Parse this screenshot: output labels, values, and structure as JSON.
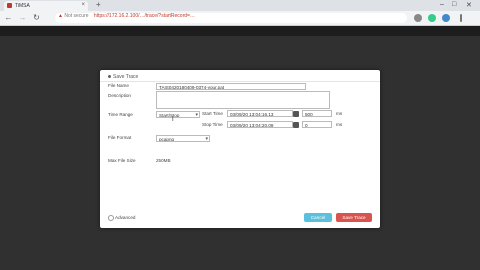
{
  "browser": {
    "tab_title": "TiMSA",
    "new_tab": "+",
    "minimize": "–",
    "maximize": "□",
    "close": "✕",
    "security_label": "Not secure",
    "url": "https://172.16.2.100/…/trace/?startRecord=…"
  },
  "dialog": {
    "title": "Save Trace",
    "file_name_label": "File Name",
    "file_name_value": "TAIS0420180409-0374-your.pat",
    "description_label": "Description",
    "description_value": "",
    "time_range_label": "Time Range",
    "time_range_value": "Start/Stop",
    "start_time_label": "Start Time",
    "start_time_value": "03/09/20 13:04:16.13",
    "start_ms_value": "500",
    "stop_time_label": "Stop Time",
    "stop_time_value": "03/09/20 13:04:20.09",
    "stop_ms_value": "0",
    "ms_unit": "ms",
    "file_format_label": "File Format",
    "file_format_value": "pcapng",
    "max_file_size_label": "Max File Size",
    "max_file_size_value": "250MB",
    "advanced_label": "Advanced",
    "cancel_label": "Cancel",
    "save_label": "Save Trace"
  },
  "colors": {
    "cancel": "#5bc0de",
    "save": "#d9534f"
  }
}
